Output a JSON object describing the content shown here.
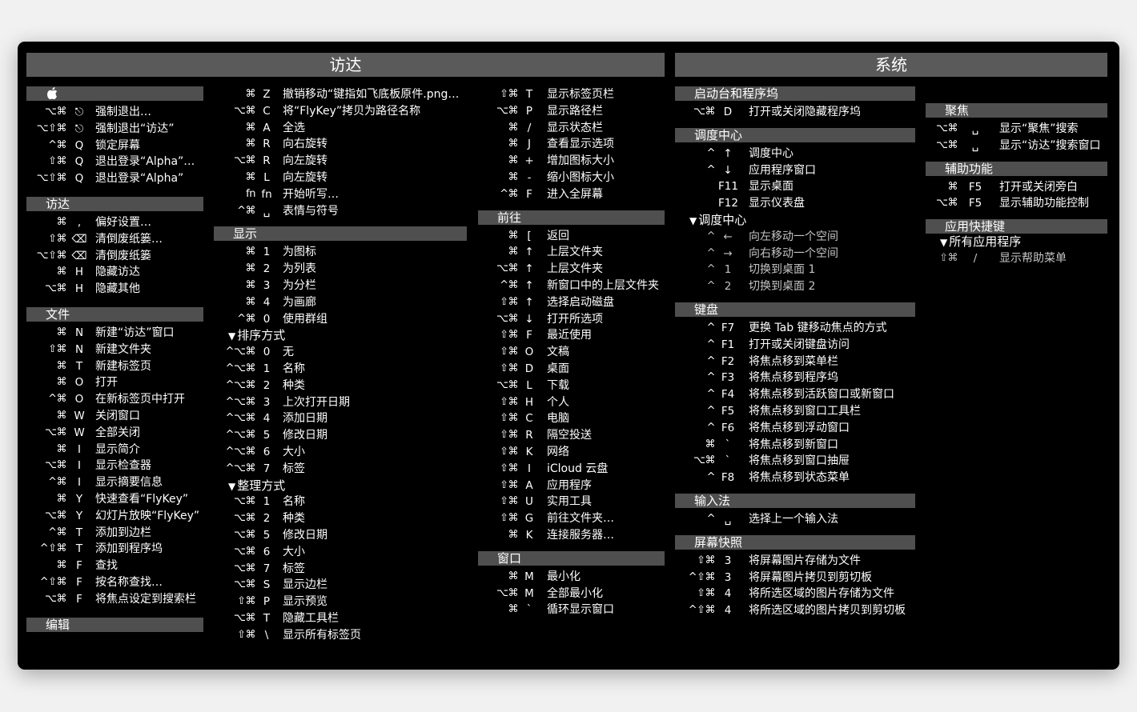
{
  "headers": {
    "finder": "访达",
    "system": "系统"
  },
  "col1": {
    "apple": {
      "items": [
        {
          "mod": "⌥⌘",
          "key": "⎋",
          "label": "强制退出…"
        },
        {
          "mod": "⌥⇧⌘",
          "key": "⎋",
          "label": "强制退出“访达”"
        },
        {
          "mod": "^⌘",
          "key": "Q",
          "label": "锁定屏幕"
        },
        {
          "mod": "⇧⌘",
          "key": "Q",
          "label": "退出登录“Alpha”…"
        },
        {
          "mod": "⌥⇧⌘",
          "key": "Q",
          "label": "退出登录“Alpha”"
        }
      ]
    },
    "finder": {
      "title": "访达",
      "items": [
        {
          "mod": "⌘",
          "key": ",",
          "label": "偏好设置…"
        },
        {
          "mod": "⇧⌘",
          "key": "⌫",
          "label": "清倒废纸篓…"
        },
        {
          "mod": "⌥⇧⌘",
          "key": "⌫",
          "label": "清倒废纸篓"
        },
        {
          "mod": "⌘",
          "key": "H",
          "label": "隐藏访达"
        },
        {
          "mod": "⌥⌘",
          "key": "H",
          "label": "隐藏其他"
        }
      ]
    },
    "file": {
      "title": "文件",
      "items": [
        {
          "mod": "⌘",
          "key": "N",
          "label": "新建“访达”窗口"
        },
        {
          "mod": "⇧⌘",
          "key": "N",
          "label": "新建文件夹"
        },
        {
          "mod": "⌘",
          "key": "T",
          "label": "新建标签页"
        },
        {
          "mod": "⌘",
          "key": "O",
          "label": "打开"
        },
        {
          "mod": "^⌘",
          "key": "O",
          "label": "在新标签页中打开"
        },
        {
          "mod": "⌘",
          "key": "W",
          "label": "关闭窗口"
        },
        {
          "mod": "⌥⌘",
          "key": "W",
          "label": "全部关闭"
        },
        {
          "mod": "⌘",
          "key": "I",
          "label": "显示简介"
        },
        {
          "mod": "⌥⌘",
          "key": "I",
          "label": "显示检查器"
        },
        {
          "mod": "^⌘",
          "key": "I",
          "label": "显示摘要信息"
        },
        {
          "mod": "⌘",
          "key": "Y",
          "label": "快速查看“FlyKey”"
        },
        {
          "mod": "⌥⌘",
          "key": "Y",
          "label": "幻灯片放映“FlyKey”"
        },
        {
          "mod": "^⌘",
          "key": "T",
          "label": "添加到边栏"
        },
        {
          "mod": "^⇧⌘",
          "key": "T",
          "label": "添加到程序坞"
        },
        {
          "mod": "⌘",
          "key": "F",
          "label": "查找"
        },
        {
          "mod": "^⇧⌘",
          "key": "F",
          "label": "按名称查找…"
        },
        {
          "mod": "⌥⌘",
          "key": "F",
          "label": "将焦点设定到搜索栏"
        }
      ]
    },
    "edit": {
      "title": "编辑"
    }
  },
  "col2": {
    "top": [
      {
        "mod": "⌘",
        "key": "Z",
        "label": "撤销移动“键指如飞底板原件.png…"
      },
      {
        "mod": "⌥⌘",
        "key": "C",
        "label": "将“FlyKey”拷贝为路径名称"
      },
      {
        "mod": "⌘",
        "key": "A",
        "label": "全选"
      },
      {
        "mod": "⌘",
        "key": "R",
        "label": "向右旋转"
      },
      {
        "mod": "⌥⌘",
        "key": "R",
        "label": "向左旋转"
      },
      {
        "mod": "⌘",
        "key": "L",
        "label": "向左旋转"
      },
      {
        "mod": "fn",
        "key": "fn",
        "label": "开始听写…"
      },
      {
        "mod": "^⌘",
        "key": "␣",
        "label": "表情与符号"
      }
    ],
    "view": {
      "title": "显示",
      "items": [
        {
          "mod": "⌘",
          "key": "1",
          "label": "为图标"
        },
        {
          "mod": "⌘",
          "key": "2",
          "label": "为列表"
        },
        {
          "mod": "⌘",
          "key": "3",
          "label": "为分栏"
        },
        {
          "mod": "⌘",
          "key": "4",
          "label": "为画廊"
        },
        {
          "mod": "^⌘",
          "key": "0",
          "label": "使用群组"
        }
      ],
      "sort_title": "排序方式",
      "sort": [
        {
          "mod": "^⌥⌘",
          "key": "0",
          "label": "无"
        },
        {
          "mod": "^⌥⌘",
          "key": "1",
          "label": "名称"
        },
        {
          "mod": "^⌥⌘",
          "key": "2",
          "label": "种类"
        },
        {
          "mod": "^⌥⌘",
          "key": "3",
          "label": "上次打开日期"
        },
        {
          "mod": "^⌥⌘",
          "key": "4",
          "label": "添加日期"
        },
        {
          "mod": "^⌥⌘",
          "key": "5",
          "label": "修改日期"
        },
        {
          "mod": "^⌥⌘",
          "key": "6",
          "label": "大小"
        },
        {
          "mod": "^⌥⌘",
          "key": "7",
          "label": "标签"
        }
      ],
      "arrange_title": "整理方式",
      "arrange": [
        {
          "mod": "⌥⌘",
          "key": "1",
          "label": "名称"
        },
        {
          "mod": "⌥⌘",
          "key": "2",
          "label": "种类"
        },
        {
          "mod": "⌥⌘",
          "key": "5",
          "label": "修改日期"
        },
        {
          "mod": "⌥⌘",
          "key": "6",
          "label": "大小"
        },
        {
          "mod": "⌥⌘",
          "key": "7",
          "label": "标签"
        },
        {
          "mod": "⌥⌘",
          "key": "S",
          "label": "显示边栏"
        },
        {
          "mod": "⇧⌘",
          "key": "P",
          "label": "显示预览"
        },
        {
          "mod": "⌥⌘",
          "key": "T",
          "label": "隐藏工具栏"
        },
        {
          "mod": "⇧⌘",
          "key": "\\",
          "label": "显示所有标签页"
        }
      ]
    }
  },
  "col3": {
    "top": [
      {
        "mod": "⇧⌘",
        "key": "T",
        "label": "显示标签页栏"
      },
      {
        "mod": "⌥⌘",
        "key": "P",
        "label": "显示路径栏"
      },
      {
        "mod": "⌘",
        "key": "/",
        "label": "显示状态栏"
      },
      {
        "mod": "⌘",
        "key": "J",
        "label": "查看显示选项"
      },
      {
        "mod": "⌘",
        "key": "+",
        "label": "增加图标大小"
      },
      {
        "mod": "⌘",
        "key": "-",
        "label": "缩小图标大小"
      },
      {
        "mod": "^⌘",
        "key": "F",
        "label": "进入全屏幕"
      }
    ],
    "go": {
      "title": "前往",
      "items": [
        {
          "mod": "⌘",
          "key": "[",
          "label": "返回"
        },
        {
          "mod": "⌘",
          "key": "↑",
          "label": "上层文件夹"
        },
        {
          "mod": "⌥⌘",
          "key": "↑",
          "label": "上层文件夹"
        },
        {
          "mod": "^⌘",
          "key": "↑",
          "label": "新窗口中的上层文件夹"
        },
        {
          "mod": "⇧⌘",
          "key": "↑",
          "label": "选择启动磁盘"
        },
        {
          "mod": "⌥⌘",
          "key": "↓",
          "label": "打开所选项"
        },
        {
          "mod": "⇧⌘",
          "key": "F",
          "label": "最近使用"
        },
        {
          "mod": "⇧⌘",
          "key": "O",
          "label": "文稿"
        },
        {
          "mod": "⇧⌘",
          "key": "D",
          "label": "桌面"
        },
        {
          "mod": "⌥⌘",
          "key": "L",
          "label": "下载"
        },
        {
          "mod": "⇧⌘",
          "key": "H",
          "label": "个人"
        },
        {
          "mod": "⇧⌘",
          "key": "C",
          "label": "电脑"
        },
        {
          "mod": "⇧⌘",
          "key": "R",
          "label": "隔空投送"
        },
        {
          "mod": "⇧⌘",
          "key": "K",
          "label": "网络"
        },
        {
          "mod": "⇧⌘",
          "key": "I",
          "label": "iCloud 云盘"
        },
        {
          "mod": "⇧⌘",
          "key": "A",
          "label": "应用程序"
        },
        {
          "mod": "⇧⌘",
          "key": "U",
          "label": "实用工具"
        },
        {
          "mod": "⇧⌘",
          "key": "G",
          "label": "前往文件夹…"
        },
        {
          "mod": "⌘",
          "key": "K",
          "label": "连接服务器…"
        }
      ]
    },
    "window": {
      "title": "窗口",
      "items": [
        {
          "mod": "⌘",
          "key": "M",
          "label": "最小化"
        },
        {
          "mod": "⌥⌘",
          "key": "M",
          "label": "全部最小化"
        },
        {
          "mod": "⌘",
          "key": "`",
          "label": "循环显示窗口"
        }
      ]
    }
  },
  "col4": {
    "launchpad": {
      "title": "启动台和程序坞",
      "items": [
        {
          "mod": "⌥⌘",
          "key": "D",
          "label": "打开或关闭隐藏程序坞"
        }
      ]
    },
    "mission": {
      "title": "调度中心",
      "items": [
        {
          "mod": "^",
          "key": "↑",
          "label": "调度中心"
        },
        {
          "mod": "^",
          "key": "↓",
          "label": "应用程序窗口"
        },
        {
          "mod": "",
          "key": "F11",
          "label": "显示桌面"
        },
        {
          "mod": "",
          "key": "F12",
          "label": "显示仪表盘"
        }
      ],
      "sub_title": "调度中心",
      "sub": [
        {
          "mod": "^",
          "key": "←",
          "label": "向左移动一个空间"
        },
        {
          "mod": "^",
          "key": "→",
          "label": "向右移动一个空间"
        },
        {
          "mod": "^",
          "key": "1",
          "label": "切换到桌面 1"
        },
        {
          "mod": "^",
          "key": "2",
          "label": "切换到桌面 2"
        }
      ]
    },
    "keyboard": {
      "title": "键盘",
      "items": [
        {
          "mod": "^",
          "key": "F7",
          "label": "更换 Tab 键移动焦点的方式"
        },
        {
          "mod": "^",
          "key": "F1",
          "label": "打开或关闭键盘访问"
        },
        {
          "mod": "^",
          "key": "F2",
          "label": "将焦点移到菜单栏"
        },
        {
          "mod": "^",
          "key": "F3",
          "label": "将焦点移到程序坞"
        },
        {
          "mod": "^",
          "key": "F4",
          "label": "将焦点移到活跃窗口或新窗口"
        },
        {
          "mod": "^",
          "key": "F5",
          "label": "将焦点移到窗口工具栏"
        },
        {
          "mod": "^",
          "key": "F6",
          "label": "将焦点移到浮动窗口"
        },
        {
          "mod": "⌘",
          "key": "`",
          "label": "将焦点移到新窗口"
        },
        {
          "mod": "⌥⌘",
          "key": "`",
          "label": "将焦点移到窗口抽屉"
        },
        {
          "mod": "^",
          "key": "F8",
          "label": "将焦点移到状态菜单"
        }
      ]
    },
    "input": {
      "title": "输入法",
      "items": [
        {
          "mod": "^",
          "key": "␣",
          "label": "选择上一个输入法"
        }
      ]
    },
    "screenshot": {
      "title": "屏幕快照",
      "items": [
        {
          "mod": "⇧⌘",
          "key": "3",
          "label": "将屏幕图片存储为文件"
        },
        {
          "mod": "^⇧⌘",
          "key": "3",
          "label": "将屏幕图片拷贝到剪切板"
        },
        {
          "mod": "⇧⌘",
          "key": "4",
          "label": "将所选区域的图片存储为文件"
        },
        {
          "mod": "^⇧⌘",
          "key": "4",
          "label": "将所选区域的图片拷贝到剪切板"
        }
      ]
    }
  },
  "col5": {
    "spotlight": {
      "title": "聚焦",
      "items": [
        {
          "mod": "⌥⌘",
          "key": "␣",
          "label": "显示“聚焦”搜索"
        },
        {
          "mod": "⌥⌘",
          "key": "␣",
          "label": "显示“访达”搜索窗口"
        }
      ]
    },
    "accessibility": {
      "title": "辅助功能",
      "items": [
        {
          "mod": "⌘",
          "key": "F5",
          "label": "打开或关闭旁白"
        },
        {
          "mod": "⌥⌘",
          "key": "F5",
          "label": "显示辅助功能控制"
        }
      ]
    },
    "appkeys": {
      "title": "应用快捷键",
      "sub_title": "所有应用程序",
      "items": [
        {
          "mod": "⇧⌘",
          "key": "/",
          "label": "显示帮助菜单"
        }
      ]
    }
  }
}
